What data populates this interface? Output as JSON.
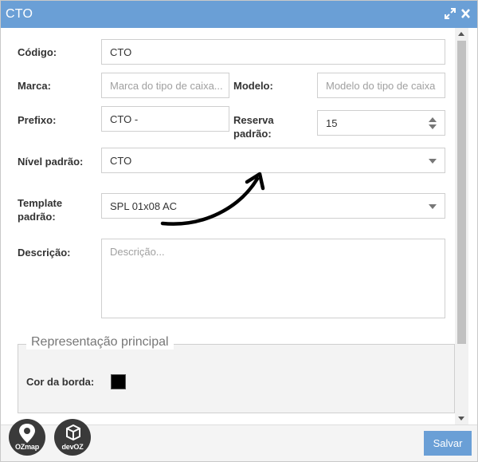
{
  "window": {
    "title": "CTO",
    "icons": [
      "expand-icon",
      "close-icon"
    ]
  },
  "form": {
    "codigo": {
      "label": "Código:",
      "value": "CTO"
    },
    "marca": {
      "label": "Marca:",
      "placeholder": "Marca do tipo de caixa..."
    },
    "modelo": {
      "label": "Modelo:",
      "placeholder": "Modelo do tipo de caixa"
    },
    "prefixo": {
      "label": "Prefixo:",
      "value": "CTO -"
    },
    "reserva": {
      "label_line1": "Reserva",
      "label_line2": "padrão:",
      "value": "15"
    },
    "nivel": {
      "label": "Nível padrão:",
      "value": "CTO"
    },
    "template": {
      "label_line1": "Template",
      "label_line2": "padrão:",
      "value": "SPL 01x08 AC"
    },
    "descricao": {
      "label": "Descrição:",
      "placeholder": "Descrição..."
    }
  },
  "representacao": {
    "legend": "Representação principal",
    "cor_borda_label": "Cor da borda:",
    "cor_borda_value": "#000000"
  },
  "footer": {
    "save_label": "Salvar",
    "logos": [
      {
        "name": "OZmap",
        "text": "OZmap"
      },
      {
        "name": "devOZ",
        "text": "devOZ"
      }
    ]
  },
  "colors": {
    "accent": "#6a9fd6",
    "label": "#333333",
    "placeholder": "#a0a0a0"
  }
}
